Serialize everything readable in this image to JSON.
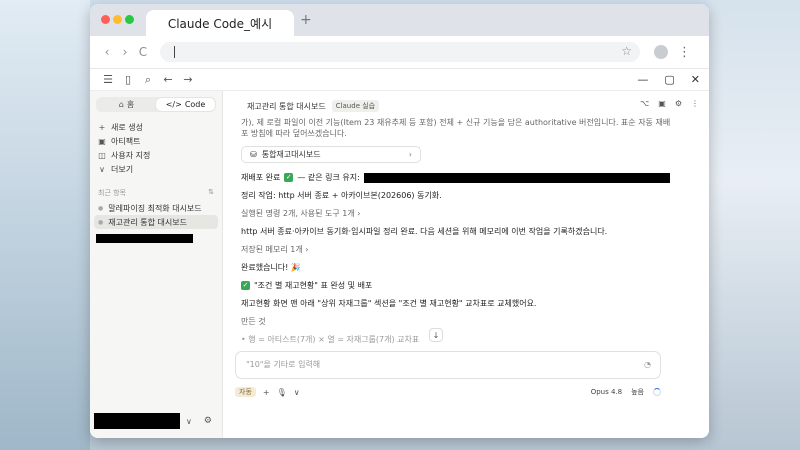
{
  "browser": {
    "tab_title": "Claude Code_예시",
    "new_tab": "+",
    "nav": {
      "back": "‹",
      "forward": "›",
      "reload": "C"
    },
    "star": "☆",
    "menu": "⋮"
  },
  "app_toolbar": {
    "icons": [
      "☰",
      "▯",
      "⌕",
      "←",
      "→"
    ],
    "window_controls": [
      "—",
      "▢",
      "✕"
    ]
  },
  "sidebar": {
    "tabs": [
      {
        "icon": "⌂",
        "label": "홈"
      },
      {
        "icon": "</>",
        "label": "Code"
      }
    ],
    "items": [
      {
        "icon": "+",
        "label": "새로 생성"
      },
      {
        "icon": "▣",
        "label": "아티팩트"
      },
      {
        "icon": "◫",
        "label": "사용자 지정"
      },
      {
        "icon": "∨",
        "label": "더보기"
      }
    ],
    "section_title": "최근 항목",
    "section_icon": "⇅",
    "projects": [
      {
        "label": "말레파이징 최적화 대시보드"
      },
      {
        "label": "재고관리 통합 대시보드"
      }
    ],
    "footer": {
      "chevron": "∨",
      "icon": "⚙"
    }
  },
  "main": {
    "title": "재고관리 통합 대시보드",
    "badge": "Claude 실습",
    "header_icons": [
      "⌥",
      "▣",
      "⚙",
      "⋮"
    ],
    "messages": [
      "가), 제 로컬 파일이 이전 기능(Item 23 재유추제 등 포함) 전체 + 신규 기능을 담은 authoritative 버전입니다. 표순 자동 재배",
      "포 방침에 따라 덮어쓰겠습니다."
    ],
    "card_label": "통합재고대시보드",
    "deploy_text": "재배포 완료",
    "deploy_suffix": "— 같은 링크 유지:",
    "cleanup_text": "정리 작업: http 서버 종료 + 아카이브본(202606) 동기화.",
    "executed_text": "실행된 명령 2개, 사용된 도구 1개 ›",
    "summary_text": "http 서버 종료·아카이브 동기화·임시파일 정리 완료. 다음 세션을 위해 메모리에 이번 작업을 기록하겠습니다.",
    "memory_text": "저장된 메모리 1개 ›",
    "done_text": "완료했습니다! 🎉",
    "task_title": "\"조건 별 재고현황\" 표 완성 및 배포",
    "task_detail": "재고현황 화면 맨 아래 \"상위 자재그룹\" 섹션을 \"조건 별 재고현황\" 교차표로 교체했어요.",
    "made_title": "만든 것",
    "faded_text": "• 행 = 아티스트(7개) × 열 = 자재그룹(7개) 교차표",
    "composer_placeholder": "\"10\"을 기타로 입력해",
    "mode_label": "자동",
    "plus": "+",
    "model_label": "Opus 4.8",
    "effort_label": "높음"
  }
}
